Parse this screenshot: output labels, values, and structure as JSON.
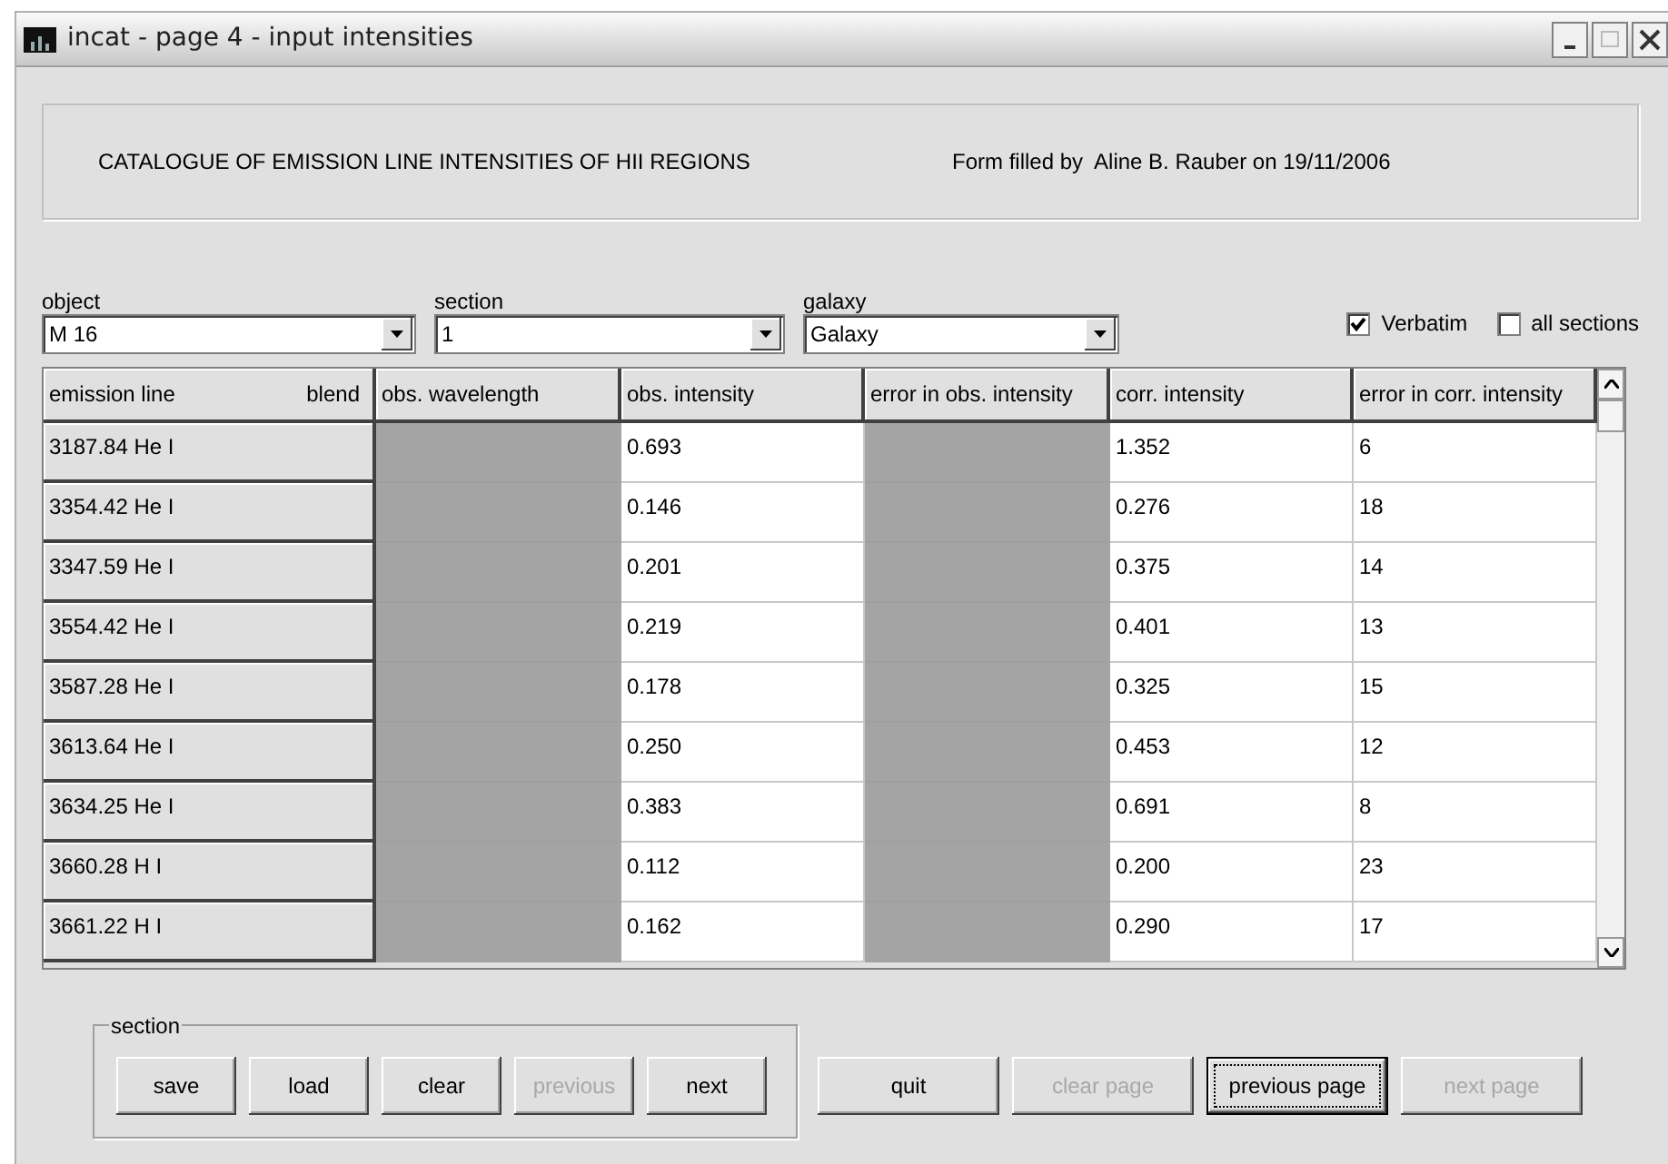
{
  "window": {
    "title": "incat - page 4 - input intensities"
  },
  "header": {
    "title": "CATALOGUE OF EMISSION LINE INTENSITIES OF HII REGIONS",
    "filled_by": "Form filled by  Aline B. Rauber on 19/11/2006"
  },
  "selectors": [
    {
      "label": "object",
      "value": "M 16"
    },
    {
      "label": "section",
      "value": "1"
    },
    {
      "label": "galaxy",
      "value": "Galaxy"
    }
  ],
  "options": [
    {
      "label": "Verbatim",
      "checked": true
    },
    {
      "label": "all sections",
      "checked": false
    }
  ],
  "table": {
    "columns": [
      {
        "label": "emission line",
        "extra": "blend",
        "kind": "label"
      },
      {
        "label": "obs. wavelength",
        "kind": "disabled"
      },
      {
        "label": "obs. intensity",
        "kind": "value"
      },
      {
        "label": "error in obs. intensity",
        "kind": "disabled"
      },
      {
        "label": "corr. intensity",
        "kind": "value"
      },
      {
        "label": "error in corr. intensity",
        "kind": "value"
      }
    ],
    "rows": [
      [
        "3187.84 He I",
        "",
        "0.693",
        "",
        "1.352",
        "6"
      ],
      [
        "3354.42 He I",
        "",
        "0.146",
        "",
        "0.276",
        "18"
      ],
      [
        "3347.59 He I",
        "",
        "0.201",
        "",
        "0.375",
        "14"
      ],
      [
        "3554.42 He I",
        "",
        "0.219",
        "",
        "0.401",
        "13"
      ],
      [
        "3587.28 He I",
        "",
        "0.178",
        "",
        "0.325",
        "15"
      ],
      [
        "3613.64 He I",
        "",
        "0.250",
        "",
        "0.453",
        "12"
      ],
      [
        "3634.25 He I",
        "",
        "0.383",
        "",
        "0.691",
        "8"
      ],
      [
        "3660.28 H I",
        "",
        "0.112",
        "",
        "0.200",
        "23"
      ],
      [
        "3661.22 H I",
        "",
        "0.162",
        "",
        "0.290",
        "17"
      ]
    ]
  },
  "section_group": {
    "label": "section",
    "buttons": [
      {
        "label": "save",
        "disabled": false
      },
      {
        "label": "load",
        "disabled": false
      },
      {
        "label": "clear",
        "disabled": false
      },
      {
        "label": "previous",
        "disabled": true
      },
      {
        "label": "next",
        "disabled": false
      }
    ]
  },
  "page_buttons": [
    {
      "label": "quit",
      "disabled": false,
      "focused": false
    },
    {
      "label": "clear page",
      "disabled": true,
      "focused": false
    },
    {
      "label": "previous page",
      "disabled": false,
      "focused": true
    },
    {
      "label": "next page",
      "disabled": true,
      "focused": false
    }
  ]
}
